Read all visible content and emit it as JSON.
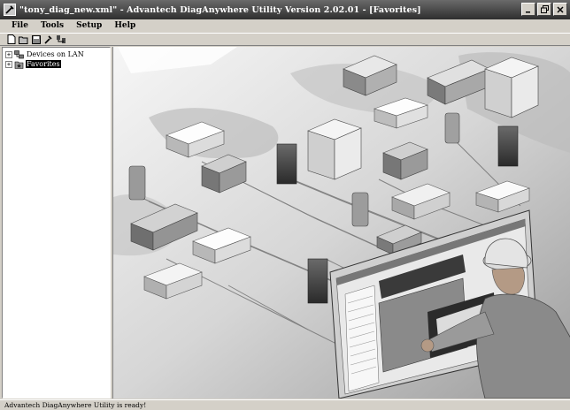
{
  "window": {
    "title": "\"tony_diag_new.xml\" - Advantech DiagAnywhere Utility Version 2.02.01 - [Favorites]",
    "app_icon": "wrench-icon",
    "buttons": [
      "minimize-icon",
      "restore-icon",
      "close-icon"
    ]
  },
  "menu": {
    "items": [
      "File",
      "Tools",
      "Setup",
      "Help"
    ]
  },
  "toolbar": {
    "buttons": [
      "new-icon",
      "open-icon",
      "save-icon",
      "tools-icon",
      "connect-icon"
    ]
  },
  "tree": {
    "items": [
      {
        "label": "Devices on LAN",
        "expander": "+",
        "icon": "lan-icon",
        "selected": false
      },
      {
        "label": "Favorites",
        "expander": "+",
        "icon": "favorites-icon",
        "selected": true
      }
    ]
  },
  "main": {
    "image": "Advantech devices illustration"
  },
  "status": {
    "text": "Advantech DiagAnywhere Utility is ready!"
  }
}
